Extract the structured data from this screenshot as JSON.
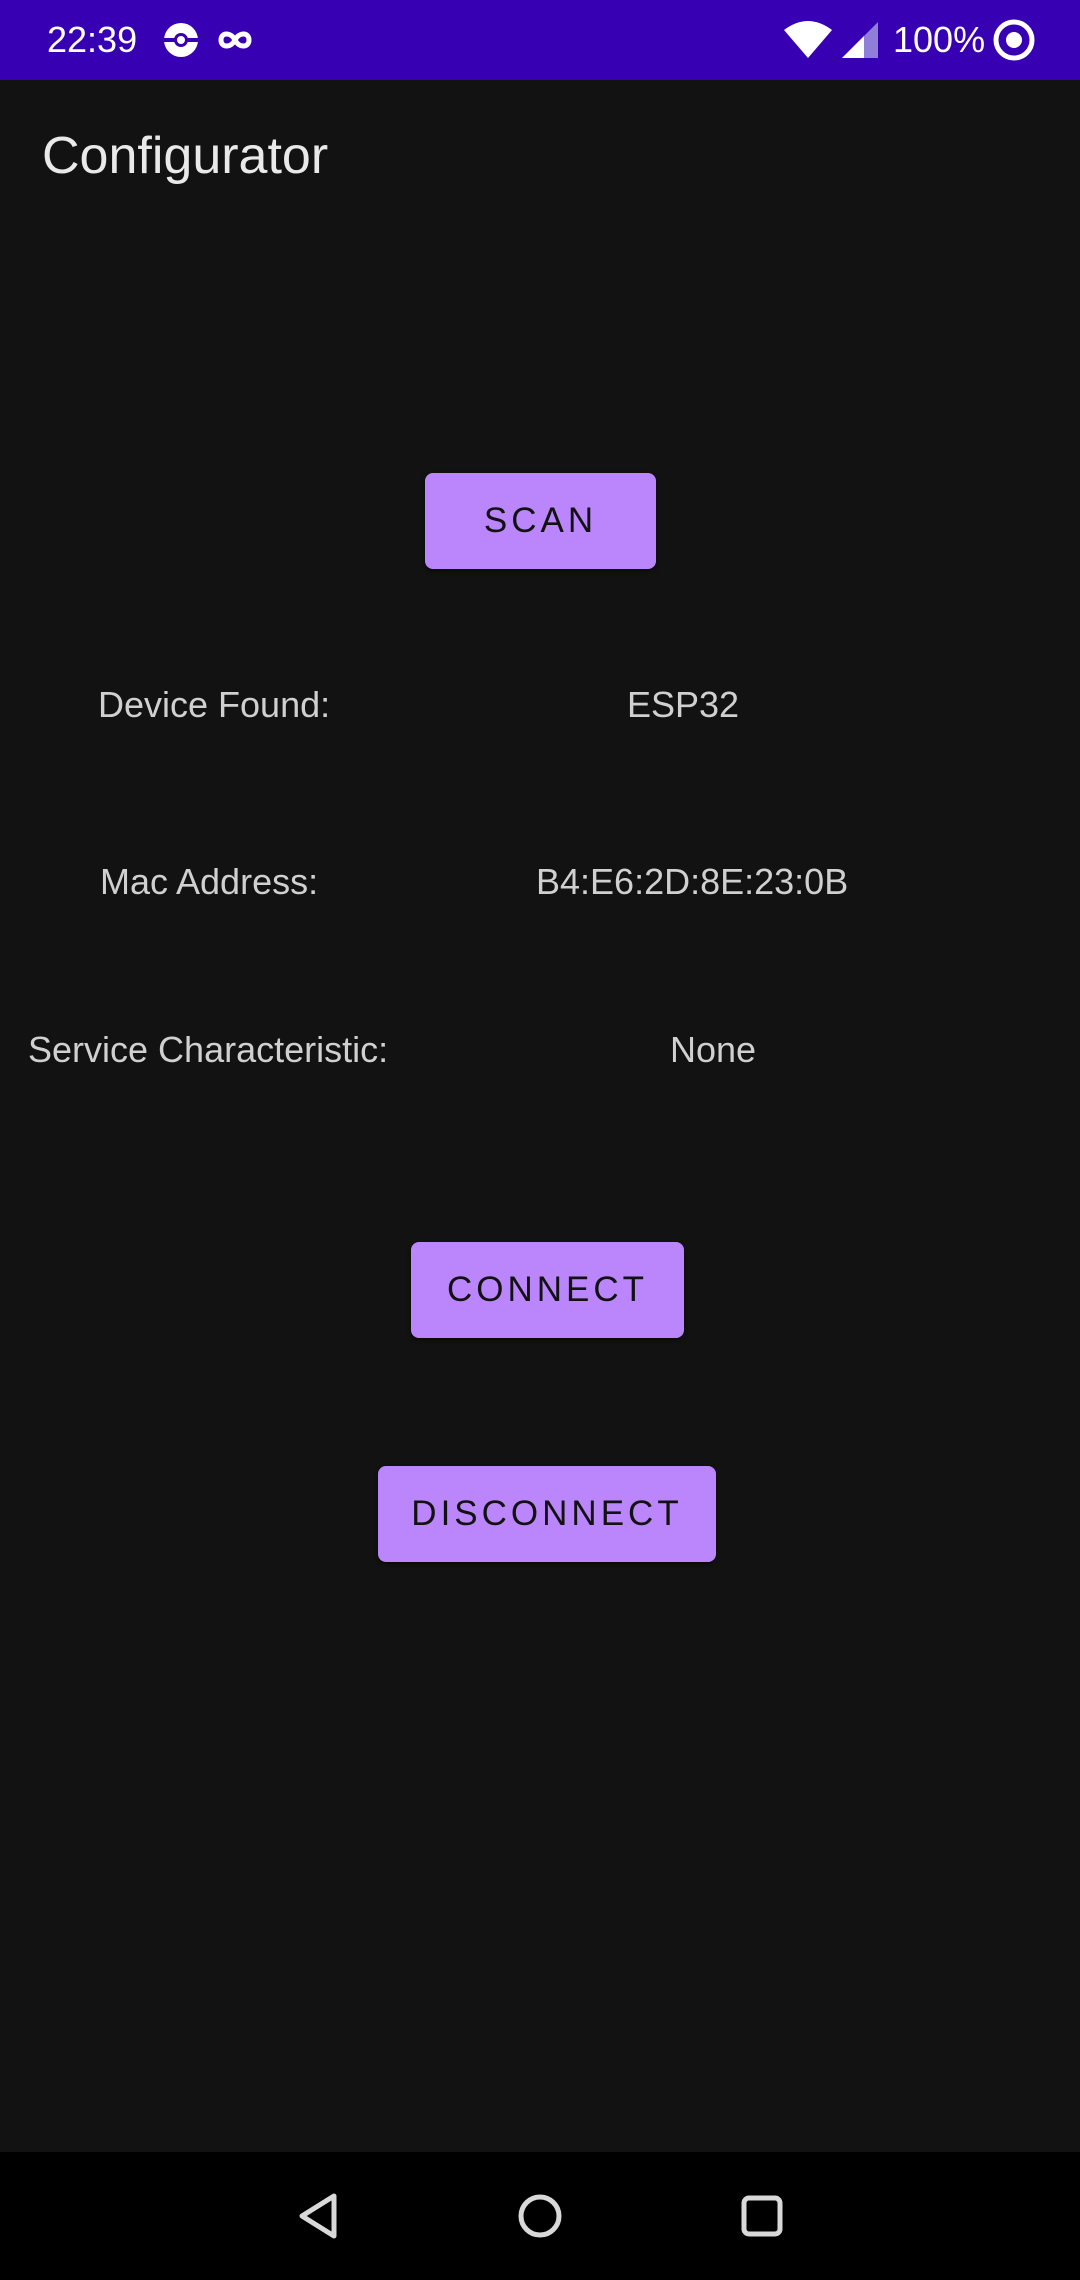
{
  "status_bar": {
    "time": "22:39",
    "battery": "100%",
    "background_color": "#3700B3",
    "left_icons": [
      "pokeball-icon",
      "infinity-icon"
    ],
    "right_icons": [
      "wifi-icon",
      "cell-signal-icon",
      "circle-target-icon"
    ]
  },
  "app_bar": {
    "title": "Configurator"
  },
  "buttons": {
    "scan": "SCAN",
    "connect": "CONNECT",
    "disconnect": "DISCONNECT",
    "color": "#BB86FC"
  },
  "device_info": {
    "device_found_label": "Device Found:",
    "device_found_value": "ESP32",
    "mac_address_label": "Mac Address:",
    "mac_address_value": "B4:E6:2D:8E:23:0B",
    "service_label": "Service Characteristic:",
    "service_value": "None"
  },
  "nav_bar": {
    "icons": [
      "back-icon",
      "home-icon",
      "recents-icon"
    ]
  }
}
